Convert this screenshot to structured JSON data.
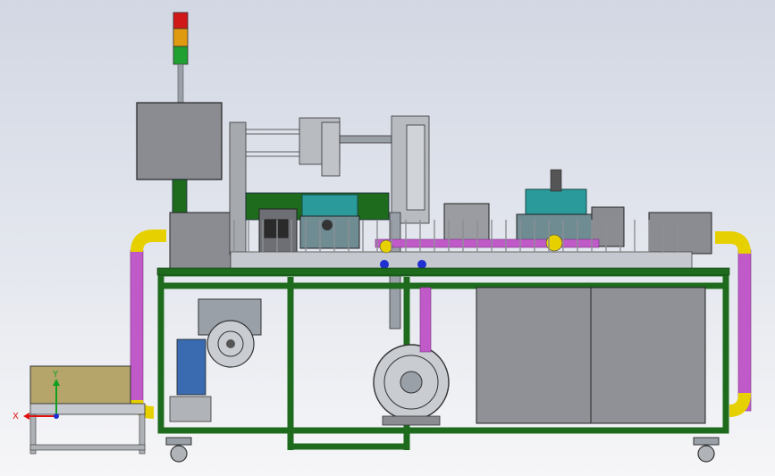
{
  "viewport": {
    "background_top": "#d2d7e3",
    "background_bottom": "#f6f6f8"
  },
  "triad": {
    "x_label": "X",
    "y_label": "Y",
    "x_color": "#e01010",
    "y_color": "#10a020",
    "z_color": "#2030d0"
  },
  "colors": {
    "frame_green": "#1e6b1e",
    "hose_magenta": "#c05ac8",
    "hose_yellow": "#e6d000",
    "panel_gray": "#8a8c91",
    "teal_block": "#2a9a9a",
    "tan_tray": "#b5a56a",
    "signal_red": "#d01818",
    "signal_amber": "#e09a10",
    "signal_green": "#20a030"
  }
}
